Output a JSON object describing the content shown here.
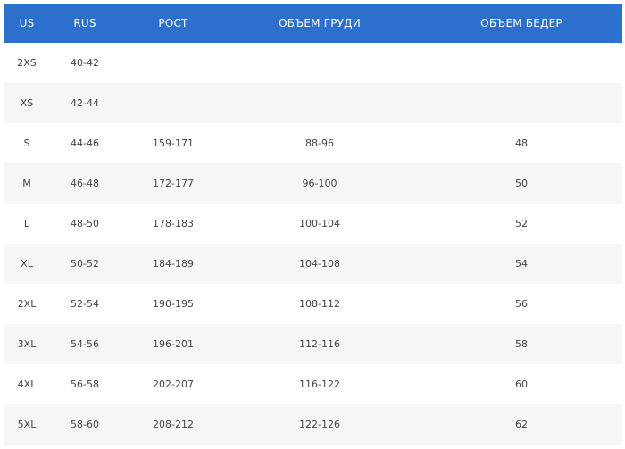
{
  "table": {
    "headers": {
      "us": "US",
      "rus": "RUS",
      "rost": "РОСТ",
      "chest": "ОБЪЕМ  ГРУДИ",
      "hips": "ОБЪЕМ БЕДЕР"
    },
    "rows": [
      {
        "us": "2XS",
        "rus": "40-42",
        "rost": "",
        "chest": "",
        "hips": ""
      },
      {
        "us": "XS",
        "rus": "42-44",
        "rost": "",
        "chest": "",
        "hips": ""
      },
      {
        "us": "S",
        "rus": "44-46",
        "rost": "159-171",
        "chest": "88-96",
        "hips": "48"
      },
      {
        "us": "M",
        "rus": "46-48",
        "rost": "172-177",
        "chest": "96-100",
        "hips": "50"
      },
      {
        "us": "L",
        "rus": "48-50",
        "rost": "178-183",
        "chest": "100-104",
        "hips": "52"
      },
      {
        "us": "XL",
        "rus": "50-52",
        "rost": "184-189",
        "chest": "104-108",
        "hips": "54"
      },
      {
        "us": "2XL",
        "rus": "52-54",
        "rost": "190-195",
        "chest": "108-112",
        "hips": "56"
      },
      {
        "us": "3XL",
        "rus": "54-56",
        "rost": "196-201",
        "chest": "112-116",
        "hips": "58"
      },
      {
        "us": "4XL",
        "rus": "56-58",
        "rost": "202-207",
        "chest": "116-122",
        "hips": "60"
      },
      {
        "us": "5XL",
        "rus": "58-60",
        "rost": "208-212",
        "chest": "122-126",
        "hips": "62"
      }
    ]
  },
  "colors": {
    "header_bg": "#2d6fcc",
    "header_text": "#ffffff",
    "stripe_bg": "#f5f6f8",
    "body_text": "#444444"
  }
}
